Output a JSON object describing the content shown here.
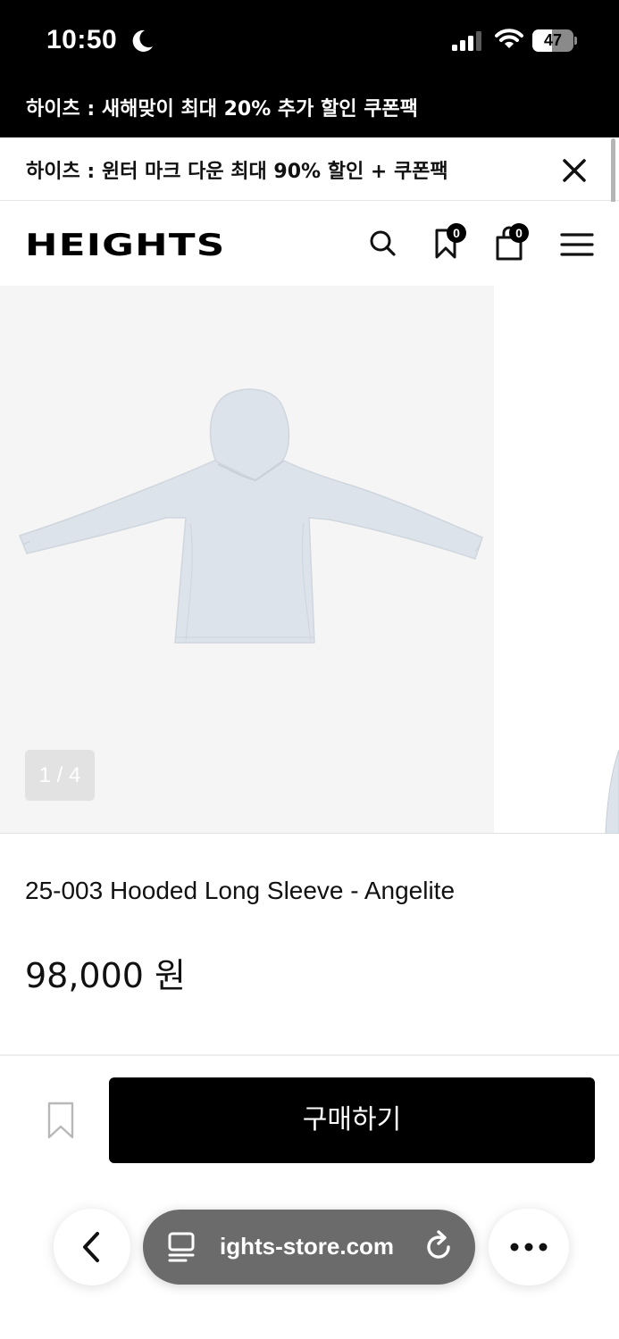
{
  "status_bar": {
    "time": "10:50",
    "battery_level": "47",
    "battery_fraction": 0.47,
    "icons": [
      "moon-icon",
      "cellular-signal-icon",
      "wifi-icon",
      "battery-icon"
    ]
  },
  "promo": {
    "top_text": "하이츠 : 새해맞이 최대 20% 추가 할인 쿠폰팩",
    "second_text": "하이츠 : 윈터 마크 다운 최대 90% 할인 + 쿠폰팩",
    "close_icon": "close-icon"
  },
  "header": {
    "logo": "HEIGHTS",
    "wishlist_count": "0",
    "cart_count": "0",
    "icons": [
      "search-icon",
      "bookmark-icon",
      "shopping-bag-icon",
      "hamburger-menu-icon"
    ]
  },
  "gallery": {
    "counter": "1 / 4",
    "current_slide": 1,
    "total_slides": 4,
    "background_color": "#f5f5f5",
    "garment_color": "#dde3ea"
  },
  "product": {
    "name": "25-003 Hooded Long Sleeve - Angelite",
    "price": "98,000 원"
  },
  "actions": {
    "buy_label": "구매하기",
    "wishlist_icon": "bookmark-outline-icon"
  },
  "browser": {
    "url": "ights-store.com",
    "icons": [
      "back-chevron-icon",
      "tabs-icon",
      "reload-icon",
      "more-dots-icon"
    ]
  },
  "colors": {
    "banner_background": "#000000",
    "buy_button": "#000000",
    "address_bar": "#6b6b6b"
  }
}
